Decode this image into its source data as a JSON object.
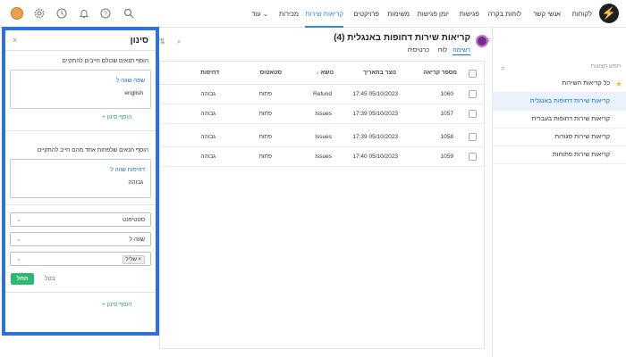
{
  "topbar": {
    "logo": "⚡",
    "nav": [
      "לקוחות",
      "אנשי קשר",
      "לוחות בקרה",
      "פגישות",
      "יומן פגישות",
      "משימות",
      "פרויקטים",
      "קריאות שירות",
      "מכירות",
      "עוד"
    ],
    "active_nav": "קריאות שירות",
    "more_chevron": "⌄"
  },
  "sidebar": {
    "search_placeholder": "חפש תצוגות",
    "items": [
      {
        "label": "כל קריאות השירות",
        "starred": true
      },
      {
        "label": "קריאות שירות דחופות באנגלית",
        "active": true
      },
      {
        "label": "קריאות שירות דחופות בעברית"
      },
      {
        "label": "קריאות שירות סגורות"
      },
      {
        "label": "קריאות שירות פתוחות"
      }
    ]
  },
  "main": {
    "title": "קריאות שירות דחופות באנגלית (4)",
    "tabs": [
      "רשימה",
      "לוח",
      "כרטיסיה"
    ],
    "active_tab": "רשימה",
    "columns": [
      "מספר קריאה",
      "נוצר בתאריך",
      "↓ נושא",
      "סטאטוס",
      "דחיפות"
    ],
    "rows": [
      {
        "id": "1060",
        "created": "17:45 05/10/2023",
        "subject": "Refund",
        "status": "פתוח",
        "urgency": "גבוהה"
      },
      {
        "id": "1057",
        "created": "17:39 05/10/2023",
        "subject": "Issues",
        "status": "פתוח",
        "urgency": "גבוהה"
      },
      {
        "id": "1058",
        "created": "17:39 05/10/2023",
        "subject": "Issues",
        "status": "פתוח",
        "urgency": "גבוהה"
      },
      {
        "id": "1059",
        "created": "17:40 05/10/2023",
        "subject": "Issues",
        "status": "פתוח",
        "urgency": "גבוהה"
      }
    ]
  },
  "filter": {
    "title": "סינון",
    "close": "×",
    "section1_text": "הוסף תנאים שכולם חייבים להתקיים",
    "section1_cond_label": "שפה שווה ל",
    "section1_cond_value": "english",
    "add_filter": "+ הוסף סינון",
    "section2_text": "הוסף תנאים שלפחות אחד מהם חייב להתקיים",
    "section2_cond_label": "דחיפות שווה ל",
    "section2_cond_value": "גבוהה",
    "select_field": "סטטיפנט",
    "select_op": "שווה ל",
    "select_value_tag": "שליל ×",
    "apply": "החל",
    "cancel": "בטל",
    "add_filter_bottom": "+ הוסף סינון"
  },
  "colors": {
    "accent": "#2a8ee0",
    "highlight_border": "#2f6fde",
    "apply_green": "#2eb872",
    "active_item_bg": "#eaf2fb"
  }
}
